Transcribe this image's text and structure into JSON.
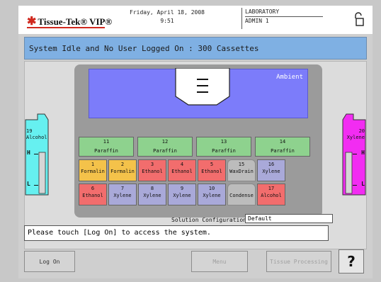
{
  "header": {
    "brand": "Tissue-Tek® VIP®",
    "date": "Friday, April 18, 2008",
    "time": "9:51",
    "location": "LABORATORY",
    "user": "ADMIN 1"
  },
  "status": "System Idle and No User Logged On  : 300 Cassettes",
  "oven": {
    "label": "Ambient"
  },
  "bottles": {
    "left": {
      "number": "19",
      "name": "Alcohol",
      "high": "H",
      "low": "L",
      "color": "#66f0f0"
    },
    "right": {
      "number": "20",
      "name": "Xylene",
      "high": "H",
      "low": "L",
      "color": "#f22cf2"
    }
  },
  "paraffin": [
    {
      "number": "11",
      "name": "Paraffin"
    },
    {
      "number": "12",
      "name": "Paraffin"
    },
    {
      "number": "13",
      "name": "Paraffin"
    },
    {
      "number": "14",
      "name": "Paraffin"
    }
  ],
  "row1": [
    {
      "number": "1",
      "name": "Formalin"
    },
    {
      "number": "2",
      "name": "Formalin"
    },
    {
      "number": "3",
      "name": "Ethanol"
    },
    {
      "number": "4",
      "name": "Ethanol"
    },
    {
      "number": "5",
      "name": "Ethanol"
    },
    {
      "number": "15",
      "name": "WaxDrain"
    },
    {
      "number": "16",
      "name": "Xylene"
    }
  ],
  "row2": [
    {
      "number": "6",
      "name": "Ethanol"
    },
    {
      "number": "7",
      "name": "Xylene"
    },
    {
      "number": "8",
      "name": "Xylene"
    },
    {
      "number": "9",
      "name": "Xylene"
    },
    {
      "number": "10",
      "name": "Xylene"
    },
    {
      "number": "",
      "name": "Condense"
    },
    {
      "number": "17",
      "name": "Alcohol"
    }
  ],
  "config": {
    "label": "Solution Configuration",
    "value": "Default"
  },
  "message": "Please touch [Log On] to access the system.",
  "buttons": {
    "log_on": "Log On",
    "menu": "Menu",
    "tissue_processing": "Tissue Processing",
    "help": "?"
  }
}
